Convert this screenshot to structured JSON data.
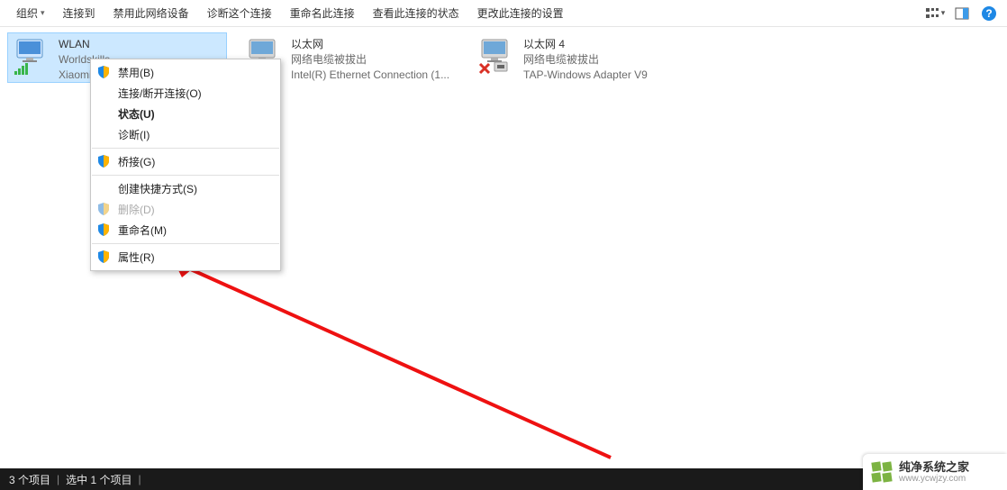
{
  "toolbar": {
    "organize": "组织",
    "connect": "连接到",
    "disable": "禁用此网络设备",
    "diagnose": "诊断这个连接",
    "rename": "重命名此连接",
    "status": "查看此连接的状态",
    "settings": "更改此连接的设置"
  },
  "adapters": [
    {
      "name": "WLAN",
      "line2": "Worldskills",
      "line3": "Xiaomi",
      "selected": true,
      "iconType": "wifi"
    },
    {
      "name": "以太网",
      "line2": "网络电缆被拔出",
      "line3": "Intel(R) Ethernet Connection (1...",
      "selected": false,
      "iconType": "ethernet"
    },
    {
      "name": "以太网 4",
      "line2": "网络电缆被拔出",
      "line3": "TAP-Windows Adapter V9",
      "selected": false,
      "iconType": "ethernet-x"
    }
  ],
  "ctx": {
    "disable": "禁用(B)",
    "connect": "连接/断开连接(O)",
    "status": "状态(U)",
    "diagnose": "诊断(I)",
    "bridge": "桥接(G)",
    "shortcut": "创建快捷方式(S)",
    "delete": "删除(D)",
    "rename": "重命名(M)",
    "properties": "属性(R)"
  },
  "statusbar": {
    "count": "3 个项目",
    "selected": "选中 1 个项目"
  },
  "watermark": {
    "title": "纯净系统之家",
    "url": "www.ycwjzy.com"
  }
}
